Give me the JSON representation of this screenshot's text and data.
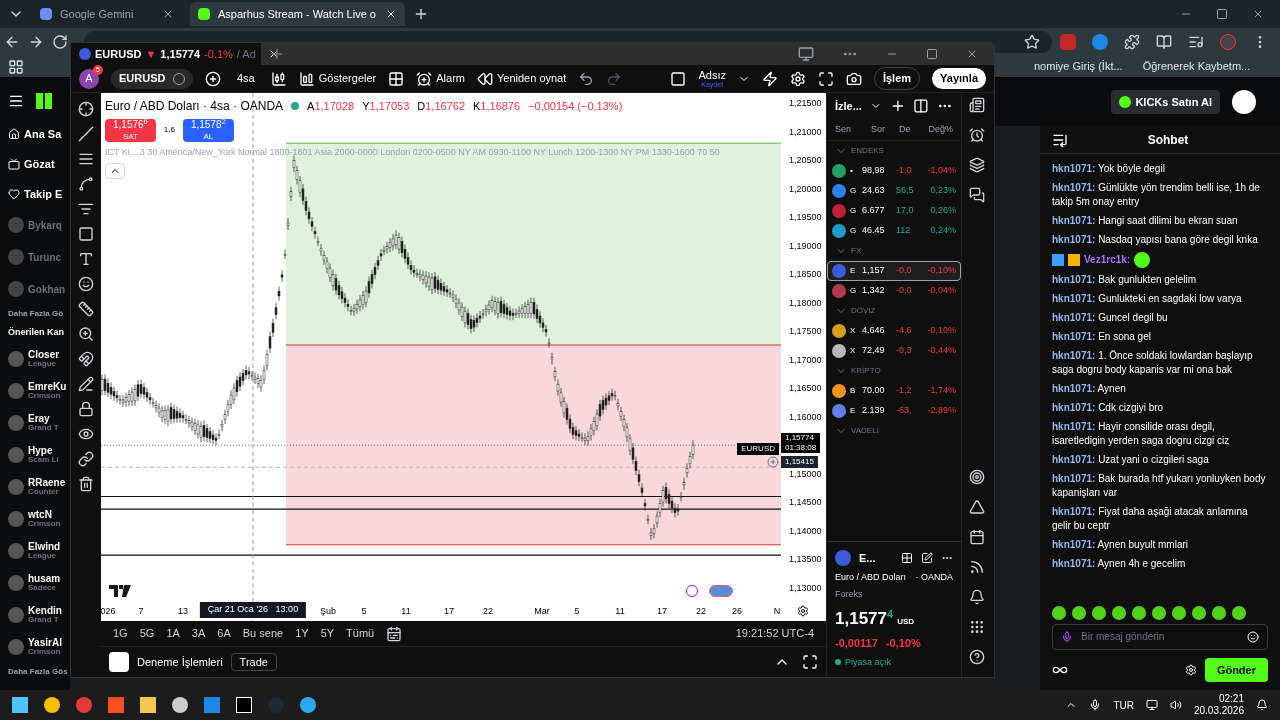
{
  "browser": {
    "tabs": [
      {
        "title": "Google Gemini",
        "selected": false
      },
      {
        "title": "Asparhus Stream - Watch Live o",
        "selected": true
      }
    ],
    "bookmarks": [
      "nomiye Giriş (İkt...",
      "Öğrenerek Kaybetm..."
    ]
  },
  "kick": {
    "nav": [
      "Ana Sa",
      "Gözat",
      "Takip E"
    ],
    "followed": [
      "Bykarq",
      "Turunc",
      "Gokhan"
    ],
    "more_followed": "Daha Fazla Gö",
    "recommended_title": "Önerilen Kan",
    "recommended": [
      {
        "name": "Closer",
        "sub": "League"
      },
      {
        "name": "EmreKu",
        "sub": "Crimson"
      },
      {
        "name": "Eray",
        "sub": "Grand T"
      },
      {
        "name": "Hype",
        "sub": "Scam Li"
      },
      {
        "name": "RRaene",
        "sub": "Counter"
      },
      {
        "name": "wtcN",
        "sub": "Crimson"
      },
      {
        "name": "Elwind",
        "sub": "League"
      },
      {
        "name": "husam",
        "sub": "Sadece"
      },
      {
        "name": "Kendin",
        "sub": "Grand T"
      },
      {
        "name": "YasirAl",
        "sub": "Crimson"
      }
    ],
    "more_recommended": "Daha Fazla Gös",
    "kicks_button": "KICKs Satın Al"
  },
  "chat": {
    "title": "Sohbet",
    "messages": [
      {
        "user": "hkn1071:",
        "color": "#93b9ee",
        "kind": "text",
        "text": "Yok böyle degil"
      },
      {
        "user": "hkn1071:",
        "color": "#93b9ee",
        "kind": "text",
        "text": "Günlükte yön trendim belli ise, 1h de takip 5m onay entry"
      },
      {
        "user": "hkn1071:",
        "color": "#93b9ee",
        "kind": "text",
        "text": "Hangi saat dilimi bu ekran suan"
      },
      {
        "user": "hkn1071:",
        "color": "#93b9ee",
        "kind": "text",
        "text": "Nasdaq yapısı bana göre degil knka"
      },
      {
        "user": "Vez1rc1k:",
        "color": "#a970ff",
        "kind": "emote"
      },
      {
        "user": "hkn1071:",
        "color": "#93b9ee",
        "kind": "text",
        "text": "Bak gunlukten gelelim"
      },
      {
        "user": "hkn1071:",
        "color": "#93b9ee",
        "kind": "text",
        "text": "Gunlukteki en sagdaki low varya"
      },
      {
        "user": "hkn1071:",
        "color": "#93b9ee",
        "kind": "text",
        "text": "Guncel degil bu"
      },
      {
        "user": "hkn1071:",
        "color": "#93b9ee",
        "kind": "text",
        "text": "En sona gel"
      },
      {
        "user": "hkn1071:",
        "color": "#93b9ee",
        "kind": "text",
        "text": "1. Önce soldaki lowlardan başlayıp saga dogru body kapanis var mi ona bak"
      },
      {
        "user": "hkn1071:",
        "color": "#93b9ee",
        "kind": "text",
        "text": "Aynen"
      },
      {
        "user": "hkn1071:",
        "color": "#93b9ee",
        "kind": "text",
        "text": "Cdk cizgiyi bro"
      },
      {
        "user": "hkn1071:",
        "color": "#93b9ee",
        "kind": "text",
        "text": "Hayir consilide orası degil, isaretledigin yerden saga dogru cizgi ciz"
      },
      {
        "user": "hkn1071:",
        "color": "#93b9ee",
        "kind": "text",
        "text": "Uzat yani o cizgileri saga"
      },
      {
        "user": "hkn1071:",
        "color": "#93b9ee",
        "kind": "text",
        "text": "Bak burada htf yukarı yonluyken body kapanişları var"
      },
      {
        "user": "hkn1071:",
        "color": "#93b9ee",
        "kind": "text",
        "text": "Fiyat daha aşaği atacak anlamına gelir bu ceptr"
      },
      {
        "user": "hkn1071:",
        "color": "#93b9ee",
        "kind": "text",
        "text": "Aynen buyult mmlari"
      },
      {
        "user": "hkn1071:",
        "color": "#93b9ee",
        "kind": "text",
        "text": "Aynen 4h e gecelim"
      }
    ],
    "placeholder": "Bir mesaj gönderin",
    "send": "Gönder"
  },
  "taskbar": {
    "lang": "TUR",
    "time": "02:21",
    "date": "20.03.2026"
  },
  "tv": {
    "tab": {
      "symbol": "EURUSD",
      "arrow": "▼",
      "price": "1,15774",
      "change": "-0.1%",
      "rest": "/ Ad"
    },
    "toolbar": {
      "avatar": "A",
      "badge": "5",
      "symbol": "EURUSD",
      "interval": "4sa",
      "indicators": "Göstergeler",
      "alarm": "Alarm",
      "replay": "Yeniden oynat",
      "layout_name": "Adsız",
      "save": "Kaydet",
      "trade": "İşlem",
      "publish": "Yayınla"
    },
    "chart": {
      "title": "Euro / ABD Doları · 4sa · OANDA",
      "ohlc": [
        {
          "label": "A",
          "value": "1,17028"
        },
        {
          "label": "Y",
          "value": "1,17053"
        },
        {
          "label": "D",
          "value": "1,16762"
        },
        {
          "label": "K",
          "value": "1,16876"
        }
      ],
      "change": "−0,00154 (−0,13%)",
      "sell": {
        "price": "1,1576$^{6}$",
        "label": "SAT"
      },
      "spread": "1,6",
      "buy": {
        "price": "1,1578$^{2}$",
        "label": "AL"
      },
      "indicator": "ICT Ki... 3 30 America/New_York Normal 1800-1801 Asia 2000-0000 London 0200-0500 NY AM 0930-1100 NY Lunch 1200-1300 NY PM 1330-1600 70 50",
      "price_axis": [
        "1,21500",
        "1,21000",
        "1,20500",
        "1,20000",
        "1,19500",
        "1,19000",
        "1,18500",
        "1,18000",
        "1,17500",
        "1,17000",
        "1,16500",
        "1,16000",
        "1,15000",
        "1,14500",
        "1,14000",
        "1,13500",
        "1,13000"
      ],
      "last_price": {
        "symbol": "EURUSD",
        "price": "1,15774",
        "countdown": "01:38:08"
      },
      "cursor_price": "1,15415",
      "time_axis": [
        {
          "label": "026",
          "kind": "tick"
        },
        {
          "label": "7",
          "kind": "tick"
        },
        {
          "label": "13",
          "kind": "tick"
        },
        {
          "label": "Çar 21 Oca '26   13:00",
          "kind": "cursor"
        },
        {
          "label": "Şub",
          "kind": "tick"
        },
        {
          "label": "5",
          "kind": "tick"
        },
        {
          "label": "11",
          "kind": "tick"
        },
        {
          "label": "17",
          "kind": "tick"
        },
        {
          "label": "22",
          "kind": "tick"
        },
        {
          "label": "Mar",
          "kind": "tick"
        },
        {
          "label": "5",
          "kind": "tick"
        },
        {
          "label": "11",
          "kind": "tick"
        },
        {
          "label": "17",
          "kind": "tick"
        },
        {
          "label": "22",
          "kind": "tick"
        },
        {
          "label": "26",
          "kind": "tick"
        },
        {
          "label": "N",
          "kind": "tick"
        }
      ],
      "ranges": [
        "1G",
        "5G",
        "1A",
        "3A",
        "6A",
        "Bu sene",
        "1Y",
        "5Y",
        "Tümü"
      ],
      "clock": "19:21:52 UTC-4"
    },
    "bottom": {
      "title": "Deneme İşlemleri",
      "button": "Trade"
    },
    "watchlist": {
      "title": "İzle...",
      "columns": [
        "Sen",
        "Sor",
        "De",
        "Değ%"
      ],
      "groups": [
        {
          "name": "ENDEKS",
          "rows": [
            {
              "color": "#22a06b",
              "symbol": "•",
              "last": "98,98",
              "change": "-1,0",
              "pct": "-1,04%",
              "positive": false,
              "selected": false
            },
            {
              "color": "#2f80ed",
              "symbol": "G",
              "last": "24.63",
              "change": "56,5",
              "pct": "0,23%",
              "positive": true,
              "selected": false
            },
            {
              "color": "#c0203a",
              "symbol": "G",
              "last": "6.677",
              "change": "17,0",
              "pct": "0,26%",
              "positive": true,
              "selected": false
            },
            {
              "color": "#1e9bc7",
              "symbol": "G",
              "last": "46.45",
              "change": "112",
              "pct": "0,24%",
              "positive": true,
              "selected": false
            }
          ]
        },
        {
          "name": "FX",
          "rows": [
            {
              "color": "#3b5bdb",
              "symbol": "E",
              "last": "1,157",
              "change": "-0,0",
              "pct": "-0,10%",
              "positive": false,
              "selected": true
            },
            {
              "color": "#b03a4a",
              "symbol": "G",
              "last": "1,342",
              "change": "-0,0",
              "pct": "-0,04%",
              "positive": false,
              "selected": false
            }
          ]
        },
        {
          "name": "DÖVİZ",
          "rows": [
            {
              "color": "#d4a017",
              "symbol": "X",
              "last": "4.646",
              "change": "-4,6",
              "pct": "-0,10%",
              "positive": false,
              "selected": false
            },
            {
              "color": "#b8b8b8",
              "symbol": "X",
              "last": "72,49",
              "change": "-0,3",
              "pct": "-0,44%",
              "positive": false,
              "selected": false
            }
          ]
        },
        {
          "name": "KRİPTO",
          "rows": [
            {
              "color": "#f7931a",
              "symbol": "B",
              "last": "70.00",
              "change": "-1,2",
              "pct": "-1,74%",
              "positive": false,
              "selected": false
            },
            {
              "color": "#627eea",
              "symbol": "E",
              "last": "2.139",
              "change": "-63,",
              "pct": "-2,89%",
              "positive": false,
              "selected": false
            }
          ]
        },
        {
          "name": "VADELİ"
        }
      ]
    },
    "details": {
      "symbol": "E...",
      "name": "Euro / ABD Doları",
      "exchange": "· OANDA",
      "category": "Foreks",
      "price": "1,1577",
      "price_last": "4",
      "currency": "USD",
      "change": "-0,00117",
      "pct": "-0,10%",
      "status": "Piyasa açık"
    }
  }
}
